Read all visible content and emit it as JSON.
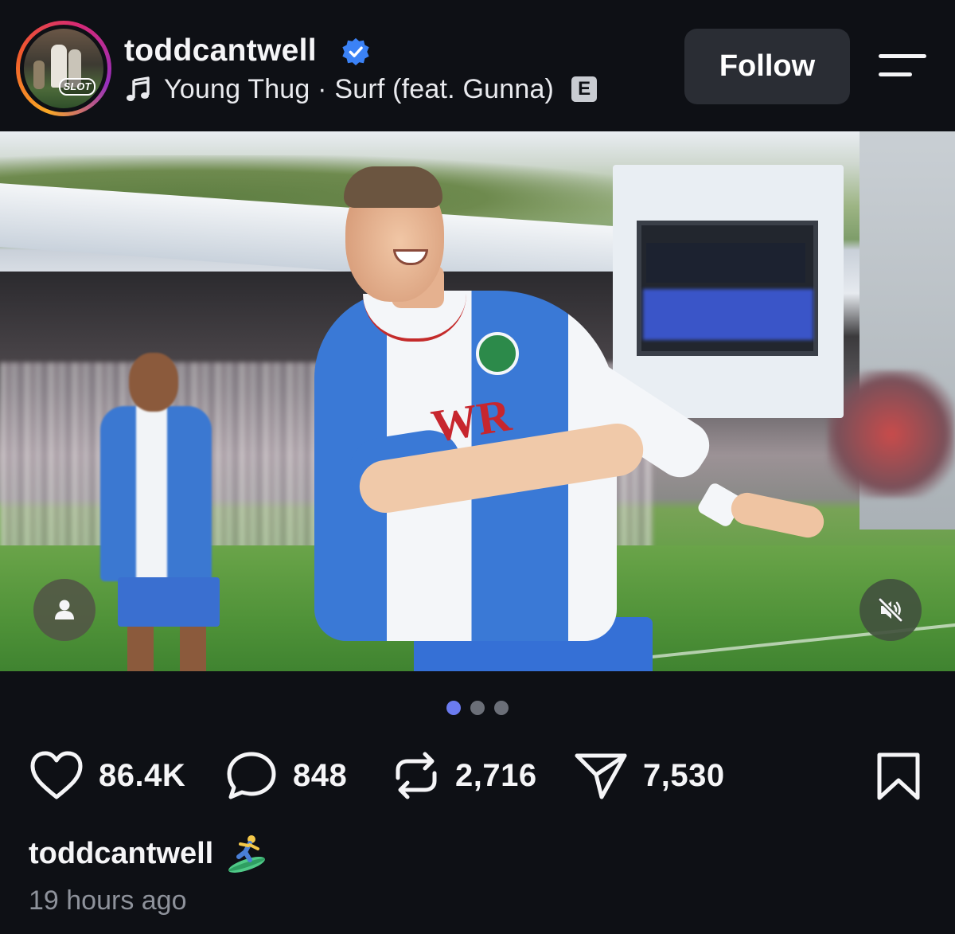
{
  "header": {
    "username": "toddcantwell",
    "verified": true,
    "avatar_badge_text": "SLOT",
    "music": {
      "track": "Young Thug · Surf (feat. Gunna)",
      "explicit_label": "E"
    },
    "follow_label": "Follow"
  },
  "media": {
    "sponsor_text": "WR",
    "carousel": {
      "count": 3,
      "active_index": 0
    }
  },
  "actions": {
    "likes": "86.4K",
    "comments": "848",
    "reposts": "2,716",
    "shares": "7,530"
  },
  "caption": {
    "username": "toddcantwell",
    "emoji": "surfer-emoji"
  },
  "timestamp": "19 hours ago",
  "colors": {
    "background": "#0e1015",
    "verified_blue": "#3b82f6",
    "follow_button_bg": "#2a2d34",
    "active_dot": "#6b7bf0",
    "inactive_dot": "#6b6f78",
    "timestamp_gray": "#8e929b"
  },
  "icons": [
    "music-note-icon",
    "verified-icon",
    "menu-icon",
    "user-tag-icon",
    "mute-icon",
    "heart-icon",
    "comment-icon",
    "repost-icon",
    "share-icon",
    "bookmark-icon"
  ]
}
